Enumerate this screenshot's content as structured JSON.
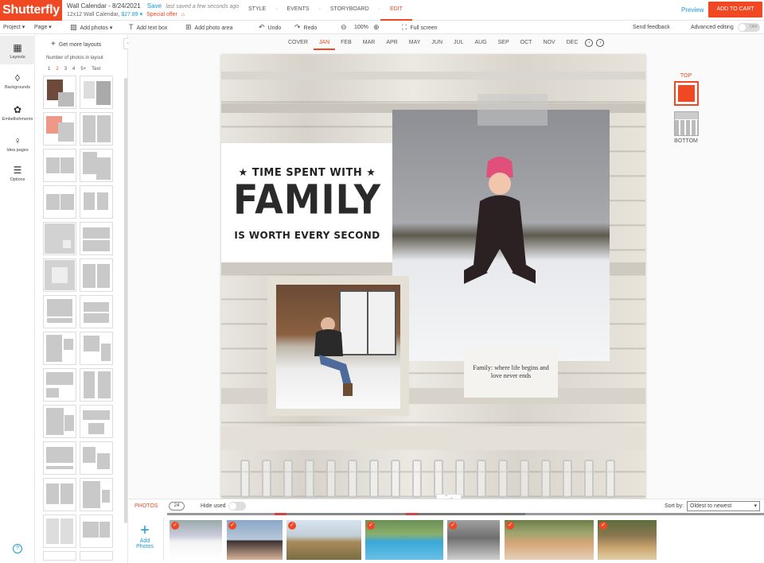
{
  "header": {
    "logo": "Shutterfly",
    "doc_title": "Wall Calendar - 8/24/2021",
    "save_label": "Save",
    "saved_status": "last saved a few seconds ago",
    "product": "12x12 Wall Calendar,",
    "price": "$27.89",
    "special_offer": "Special offer",
    "steps": [
      "STYLE",
      "EVENTS",
      "STORYBOARD",
      "EDIT"
    ],
    "preview": "Preview",
    "add_to_cart": "ADD TO CART"
  },
  "toolbar": {
    "project": "Project",
    "page": "Page",
    "add_photos": "Add photos",
    "add_text_box": "Add text box",
    "add_photo_area": "Add photo area",
    "undo": "Undo",
    "redo": "Redo",
    "zoom": "100%",
    "full_screen": "Full screen",
    "send_feedback": "Send feedback",
    "advanced_editing": "Advanced editing",
    "toggle_state": "OFF"
  },
  "rail": {
    "items": [
      "Layouts",
      "Backgrounds",
      "Embellishments",
      "Idea pages",
      "Options"
    ],
    "help": "?"
  },
  "layouts_panel": {
    "get_more": "Get more layouts",
    "num_label": "Number of photos in layout",
    "num_tabs": [
      "1",
      "2",
      "3",
      "4",
      "5+",
      "Text"
    ],
    "active_tab": "2"
  },
  "canvas": {
    "months": [
      "COVER",
      "JAN",
      "FEB",
      "MAR",
      "APR",
      "MAY",
      "JUN",
      "JUL",
      "AUG",
      "SEP",
      "OCT",
      "NOV",
      "DEC"
    ],
    "active_month": "JAN",
    "quote_line1": "★ TIME SPENT WITH ★",
    "quote_line2": "FAMILY",
    "quote_line3": "IS WORTH EVERY SECOND",
    "caption_line1": "Family: where life begins and",
    "caption_line2": "love never ends",
    "side_top": "TOP",
    "side_bottom": "BOTTOM"
  },
  "tray": {
    "photos_tab": "PHOTOS",
    "count": "24",
    "hide_used": "Hide used",
    "sort_by": "Sort by:",
    "sort_value": "Oldest to newest",
    "add_photos_line1": "Add",
    "add_photos_line2": "Photos"
  },
  "colors": {
    "accent": "#ef4823",
    "link": "#1a9ad6"
  }
}
